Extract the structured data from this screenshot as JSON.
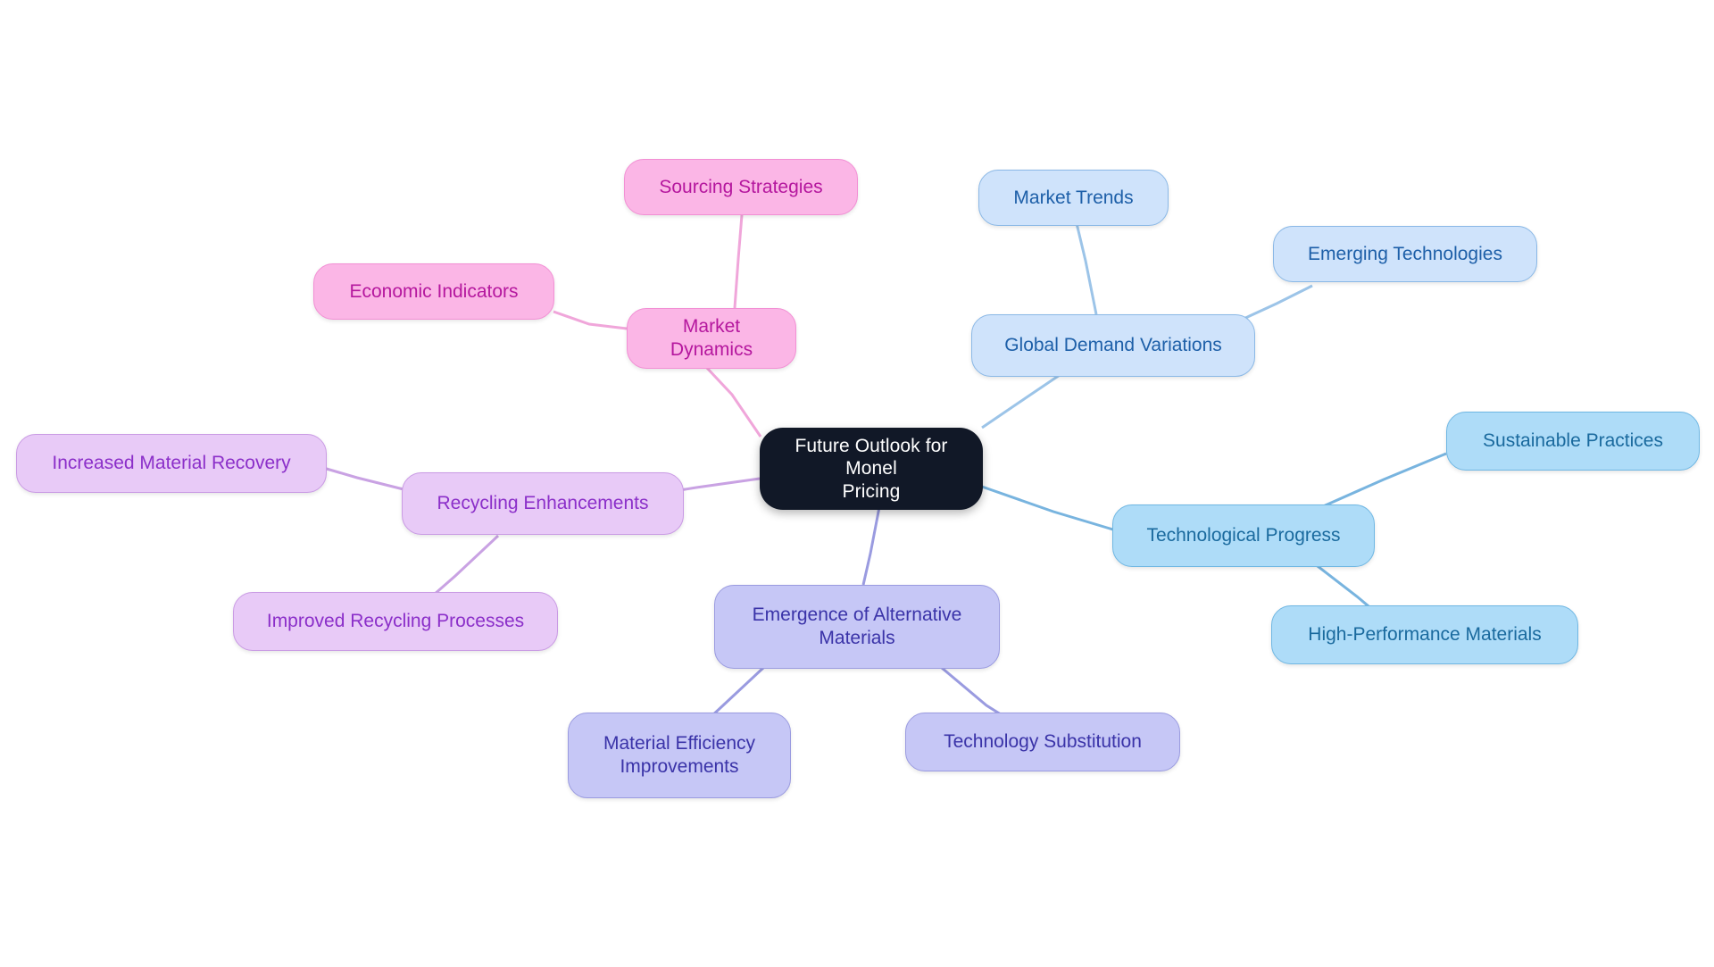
{
  "diagram": {
    "type": "mindmap",
    "title": "Future Outlook for Monel Pricing",
    "background": "#ffffff",
    "palette": {
      "root_fill": "#111827",
      "root_text": "#ffffff",
      "pink_fill": "#fbb6e6",
      "pink_border": "#f28fd4",
      "pink_text": "#b5179e",
      "blue_light_fill": "#cfe3fb",
      "blue_light_border": "#8ab8e6",
      "blue_light_text": "#1d5fa8",
      "blue_mid_fill": "#aedcf8",
      "blue_mid_border": "#6fb7e3",
      "blue_mid_text": "#1a6a9e",
      "violet_fill": "#e8caf7",
      "violet_border": "#c99ae4",
      "violet_text": "#8b2fc9",
      "indigo_fill": "#c6c7f6",
      "indigo_border": "#9a9be0",
      "indigo_text": "#3a33a8",
      "edge_pink": "#f0a6da",
      "edge_blue_light": "#9cc4e8",
      "edge_blue_mid": "#78b4df",
      "edge_violet": "#c9a2e3",
      "edge_indigo": "#9a9be0"
    }
  },
  "nodes": {
    "root": {
      "label": "Future Outlook for Monel\nPricing"
    },
    "market_dynamics": {
      "label": "Market Dynamics"
    },
    "sourcing_strategies": {
      "label": "Sourcing Strategies"
    },
    "economic_indicators": {
      "label": "Economic Indicators"
    },
    "global_demand_variations": {
      "label": "Global Demand Variations"
    },
    "market_trends": {
      "label": "Market Trends"
    },
    "emerging_technologies": {
      "label": "Emerging Technologies"
    },
    "technological_progress": {
      "label": "Technological Progress"
    },
    "sustainable_practices": {
      "label": "Sustainable Practices"
    },
    "high_performance_materials": {
      "label": "High-Performance Materials"
    },
    "recycling_enhancements": {
      "label": "Recycling Enhancements"
    },
    "increased_material_recovery": {
      "label": "Increased Material Recovery"
    },
    "improved_recycling_processes": {
      "label": "Improved Recycling Processes"
    },
    "emergence_alternative_materials": {
      "label": "Emergence of Alternative\nMaterials"
    },
    "material_efficiency_improvements": {
      "label": "Material Efficiency\nImprovements"
    },
    "technology_substitution": {
      "label": "Technology Substitution"
    }
  },
  "chart_data": {
    "type": "mindmap",
    "title": "Future Outlook for Monel Pricing",
    "center": "Future Outlook for Monel Pricing",
    "branches": [
      {
        "name": "Market Dynamics",
        "color": "#fbb6e6",
        "children": [
          "Sourcing Strategies",
          "Economic Indicators"
        ]
      },
      {
        "name": "Global Demand Variations",
        "color": "#cfe3fb",
        "children": [
          "Market Trends",
          "Emerging Technologies"
        ]
      },
      {
        "name": "Technological Progress",
        "color": "#aedcf8",
        "children": [
          "Sustainable Practices",
          "High-Performance Materials"
        ]
      },
      {
        "name": "Recycling Enhancements",
        "color": "#e8caf7",
        "children": [
          "Increased Material Recovery",
          "Improved Recycling Processes"
        ]
      },
      {
        "name": "Emergence of Alternative Materials",
        "color": "#c6c7f6",
        "children": [
          "Material Efficiency Improvements",
          "Technology Substitution"
        ]
      }
    ]
  }
}
